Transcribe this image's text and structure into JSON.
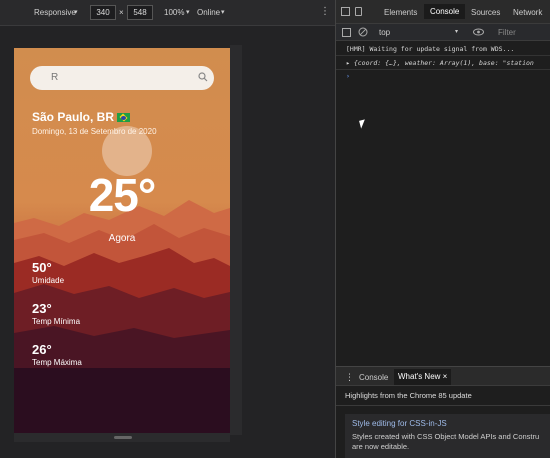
{
  "device_toolbar": {
    "mode": "Responsive",
    "width": "340",
    "times": "×",
    "height": "548",
    "zoom": "100%",
    "network": "Online"
  },
  "weather": {
    "search_placeholder": "R",
    "city": "São Paulo, BR",
    "date": "Domingo, 13 de Setembro de 2020",
    "temperature": "25°",
    "period": "Agora",
    "stats": [
      {
        "value": "50°",
        "label": "Umidade"
      },
      {
        "value": "23°",
        "label": "Temp Mínima"
      },
      {
        "value": "26°",
        "label": "Temp Máxima"
      }
    ]
  },
  "devtools": {
    "tabs": [
      "Elements",
      "Console",
      "Sources",
      "Network"
    ],
    "active_tab": "Console",
    "context": "top",
    "filter_placeholder": "Filter",
    "console_lines": [
      "[HMR] Waiting for update signal from WDS...",
      "▸ {coord: {…}, weather: Array(1), base: \"station",
      "›"
    ],
    "drawer_tabs": [
      "Console",
      "What's New"
    ],
    "drawer_close": "×",
    "highlights": "Highlights from the Chrome 85 update",
    "card_title": "Style editing for CSS-in-JS",
    "card_desc": "Styles created with CSS Object Model APIs and Constru",
    "card_desc2": "are now editable."
  },
  "colors": {
    "sky": "#d18d4e",
    "mountain_far": "#c2553a",
    "mountain_mid": "#9b2b24",
    "mountain_near": "#5a1a24",
    "ground": "#2b0d1f",
    "link": "#9fbbe9"
  }
}
